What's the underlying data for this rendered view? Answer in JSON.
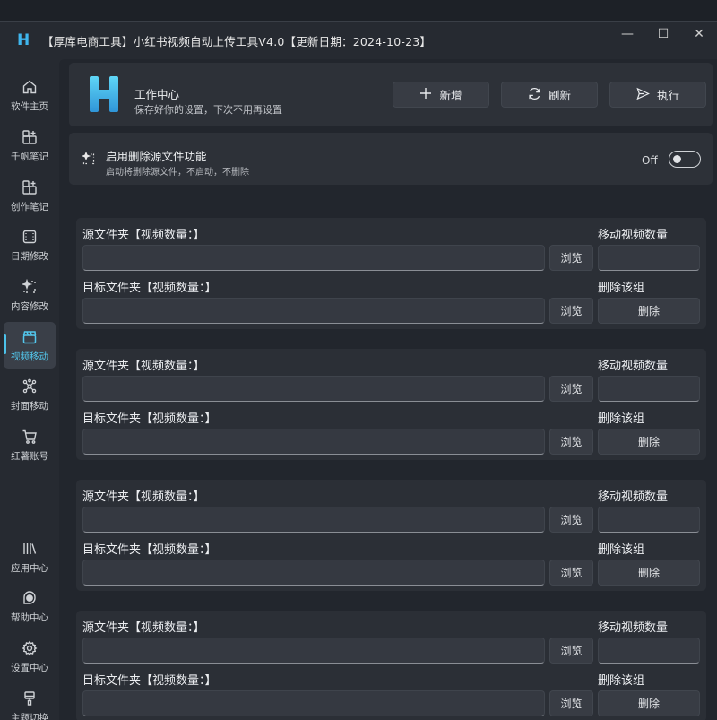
{
  "window": {
    "title": "【厚库电商工具】小红书视频自动上传工具V4.0【更新日期：2024-10-23】",
    "logo_letter": "H",
    "controls": [
      "—",
      "☐",
      "✕"
    ]
  },
  "sidebar": {
    "items": [
      {
        "label": "软件主页",
        "icon": "home-icon",
        "active": false
      },
      {
        "label": "千帆笔记",
        "icon": "grid-plus-icon",
        "active": false
      },
      {
        "label": "创作笔记",
        "icon": "grid-plus-icon",
        "active": false
      },
      {
        "label": "日期修改",
        "icon": "film-frame-icon",
        "active": false
      },
      {
        "label": "内容修改",
        "icon": "sparkle-select-icon",
        "active": false
      },
      {
        "label": "视频移动",
        "icon": "clapper-icon",
        "active": true
      },
      {
        "label": "封面移动",
        "icon": "network-icon",
        "active": false
      },
      {
        "label": "红薯账号",
        "icon": "cart-icon",
        "active": false
      },
      {
        "label": "应用中心",
        "icon": "library-icon",
        "active": false
      },
      {
        "label": "帮助中心",
        "icon": "chat-help-icon",
        "active": false
      },
      {
        "label": "设置中心",
        "icon": "gear-icon",
        "active": false
      },
      {
        "label": "主题切换",
        "icon": "brush-icon",
        "active": false
      }
    ]
  },
  "header": {
    "logo_letter": "H",
    "title": "工作中心",
    "subtitle": "保存好你的设置，下次不用再设置",
    "buttons": {
      "add": {
        "label": "新增",
        "icon": "plus-icon"
      },
      "refresh": {
        "label": "刷新",
        "icon": "refresh-icon"
      },
      "run": {
        "label": "执行",
        "icon": "send-icon"
      }
    }
  },
  "option": {
    "title": "启用删除源文件功能",
    "subtitle": "启动将删除源文件，不启动，不删除",
    "state_label": "Off",
    "enabled": false
  },
  "groups": [
    {
      "source_label": "源文件夹【视频数量：】",
      "target_label": "目标文件夹【视频数量：】",
      "move_count_label": "移动视频数量",
      "delete_group_label": "删除该组",
      "browse_label": "浏览",
      "delete_label": "删除",
      "source_value": "",
      "target_value": "",
      "move_count_value": ""
    },
    {
      "source_label": "源文件夹【视频数量：】",
      "target_label": "目标文件夹【视频数量：】",
      "move_count_label": "移动视频数量",
      "delete_group_label": "删除该组",
      "browse_label": "浏览",
      "delete_label": "删除",
      "source_value": "",
      "target_value": "",
      "move_count_value": ""
    },
    {
      "source_label": "源文件夹【视频数量：】",
      "target_label": "目标文件夹【视频数量：】",
      "move_count_label": "移动视频数量",
      "delete_group_label": "删除该组",
      "browse_label": "浏览",
      "delete_label": "删除",
      "source_value": "",
      "target_value": "",
      "move_count_value": ""
    },
    {
      "source_label": "源文件夹【视频数量：】",
      "target_label": "目标文件夹【视频数量：】",
      "move_count_label": "移动视频数量",
      "delete_group_label": "删除该组",
      "browse_label": "浏览",
      "delete_label": "删除",
      "source_value": "",
      "target_value": "",
      "move_count_value": ""
    }
  ],
  "colors": {
    "accent": "#4cc2ea",
    "window_bg": "#262a31",
    "card_bg": "#2d3138",
    "input_bg": "#353941"
  }
}
